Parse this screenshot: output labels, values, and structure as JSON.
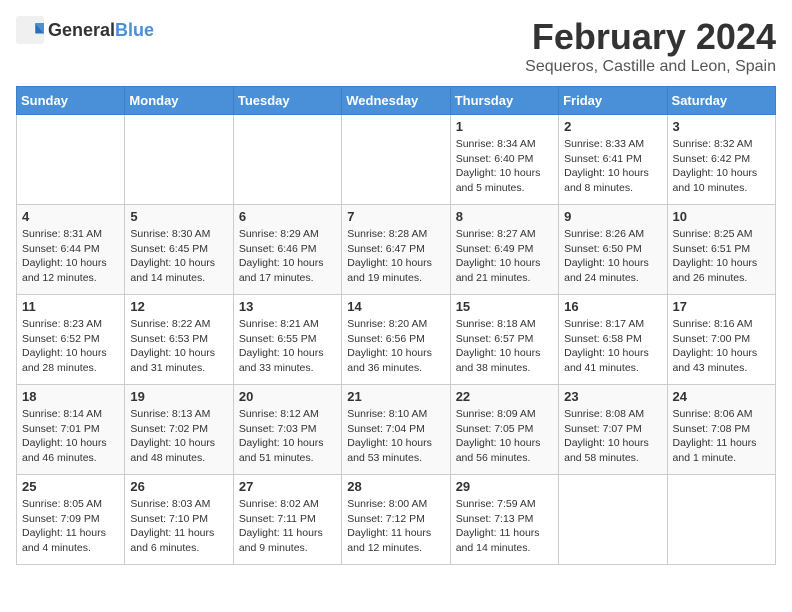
{
  "header": {
    "logo_general": "General",
    "logo_blue": "Blue",
    "month_year": "February 2024",
    "location": "Sequeros, Castille and Leon, Spain"
  },
  "calendar": {
    "days_of_week": [
      "Sunday",
      "Monday",
      "Tuesday",
      "Wednesday",
      "Thursday",
      "Friday",
      "Saturday"
    ],
    "weeks": [
      [
        {
          "day": "",
          "info": ""
        },
        {
          "day": "",
          "info": ""
        },
        {
          "day": "",
          "info": ""
        },
        {
          "day": "",
          "info": ""
        },
        {
          "day": "1",
          "info": "Sunrise: 8:34 AM\nSunset: 6:40 PM\nDaylight: 10 hours\nand 5 minutes."
        },
        {
          "day": "2",
          "info": "Sunrise: 8:33 AM\nSunset: 6:41 PM\nDaylight: 10 hours\nand 8 minutes."
        },
        {
          "day": "3",
          "info": "Sunrise: 8:32 AM\nSunset: 6:42 PM\nDaylight: 10 hours\nand 10 minutes."
        }
      ],
      [
        {
          "day": "4",
          "info": "Sunrise: 8:31 AM\nSunset: 6:44 PM\nDaylight: 10 hours\nand 12 minutes."
        },
        {
          "day": "5",
          "info": "Sunrise: 8:30 AM\nSunset: 6:45 PM\nDaylight: 10 hours\nand 14 minutes."
        },
        {
          "day": "6",
          "info": "Sunrise: 8:29 AM\nSunset: 6:46 PM\nDaylight: 10 hours\nand 17 minutes."
        },
        {
          "day": "7",
          "info": "Sunrise: 8:28 AM\nSunset: 6:47 PM\nDaylight: 10 hours\nand 19 minutes."
        },
        {
          "day": "8",
          "info": "Sunrise: 8:27 AM\nSunset: 6:49 PM\nDaylight: 10 hours\nand 21 minutes."
        },
        {
          "day": "9",
          "info": "Sunrise: 8:26 AM\nSunset: 6:50 PM\nDaylight: 10 hours\nand 24 minutes."
        },
        {
          "day": "10",
          "info": "Sunrise: 8:25 AM\nSunset: 6:51 PM\nDaylight: 10 hours\nand 26 minutes."
        }
      ],
      [
        {
          "day": "11",
          "info": "Sunrise: 8:23 AM\nSunset: 6:52 PM\nDaylight: 10 hours\nand 28 minutes."
        },
        {
          "day": "12",
          "info": "Sunrise: 8:22 AM\nSunset: 6:53 PM\nDaylight: 10 hours\nand 31 minutes."
        },
        {
          "day": "13",
          "info": "Sunrise: 8:21 AM\nSunset: 6:55 PM\nDaylight: 10 hours\nand 33 minutes."
        },
        {
          "day": "14",
          "info": "Sunrise: 8:20 AM\nSunset: 6:56 PM\nDaylight: 10 hours\nand 36 minutes."
        },
        {
          "day": "15",
          "info": "Sunrise: 8:18 AM\nSunset: 6:57 PM\nDaylight: 10 hours\nand 38 minutes."
        },
        {
          "day": "16",
          "info": "Sunrise: 8:17 AM\nSunset: 6:58 PM\nDaylight: 10 hours\nand 41 minutes."
        },
        {
          "day": "17",
          "info": "Sunrise: 8:16 AM\nSunset: 7:00 PM\nDaylight: 10 hours\nand 43 minutes."
        }
      ],
      [
        {
          "day": "18",
          "info": "Sunrise: 8:14 AM\nSunset: 7:01 PM\nDaylight: 10 hours\nand 46 minutes."
        },
        {
          "day": "19",
          "info": "Sunrise: 8:13 AM\nSunset: 7:02 PM\nDaylight: 10 hours\nand 48 minutes."
        },
        {
          "day": "20",
          "info": "Sunrise: 8:12 AM\nSunset: 7:03 PM\nDaylight: 10 hours\nand 51 minutes."
        },
        {
          "day": "21",
          "info": "Sunrise: 8:10 AM\nSunset: 7:04 PM\nDaylight: 10 hours\nand 53 minutes."
        },
        {
          "day": "22",
          "info": "Sunrise: 8:09 AM\nSunset: 7:05 PM\nDaylight: 10 hours\nand 56 minutes."
        },
        {
          "day": "23",
          "info": "Sunrise: 8:08 AM\nSunset: 7:07 PM\nDaylight: 10 hours\nand 58 minutes."
        },
        {
          "day": "24",
          "info": "Sunrise: 8:06 AM\nSunset: 7:08 PM\nDaylight: 11 hours\nand 1 minute."
        }
      ],
      [
        {
          "day": "25",
          "info": "Sunrise: 8:05 AM\nSunset: 7:09 PM\nDaylight: 11 hours\nand 4 minutes."
        },
        {
          "day": "26",
          "info": "Sunrise: 8:03 AM\nSunset: 7:10 PM\nDaylight: 11 hours\nand 6 minutes."
        },
        {
          "day": "27",
          "info": "Sunrise: 8:02 AM\nSunset: 7:11 PM\nDaylight: 11 hours\nand 9 minutes."
        },
        {
          "day": "28",
          "info": "Sunrise: 8:00 AM\nSunset: 7:12 PM\nDaylight: 11 hours\nand 12 minutes."
        },
        {
          "day": "29",
          "info": "Sunrise: 7:59 AM\nSunset: 7:13 PM\nDaylight: 11 hours\nand 14 minutes."
        },
        {
          "day": "",
          "info": ""
        },
        {
          "day": "",
          "info": ""
        }
      ]
    ]
  }
}
